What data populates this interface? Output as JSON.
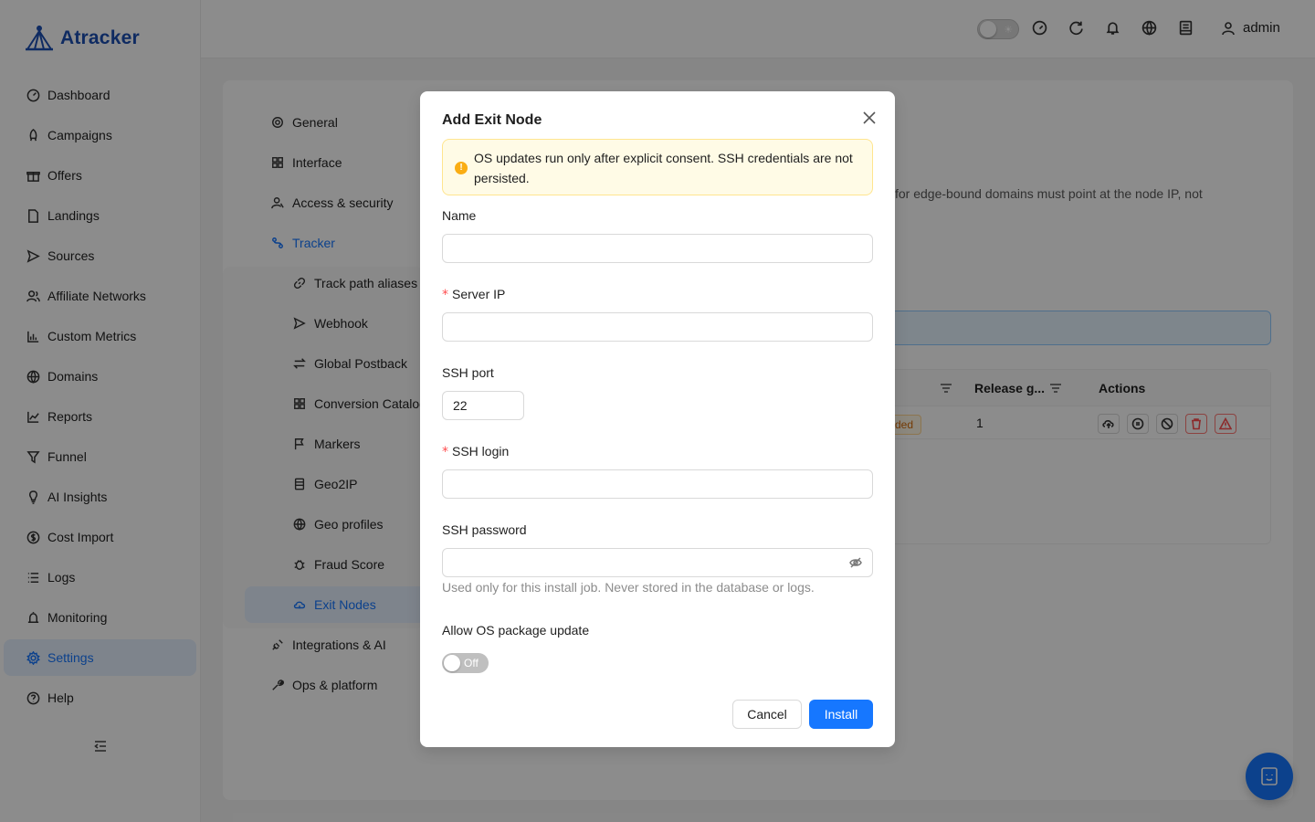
{
  "app": {
    "logo_text": "Atracker"
  },
  "sidebar": {
    "items": [
      {
        "label": "Dashboard",
        "icon": "dashboard-icon"
      },
      {
        "label": "Campaigns",
        "icon": "rocket-icon"
      },
      {
        "label": "Offers",
        "icon": "gift-icon"
      },
      {
        "label": "Landings",
        "icon": "file-icon"
      },
      {
        "label": "Sources",
        "icon": "send-icon"
      },
      {
        "label": "Affiliate Networks",
        "icon": "team-icon"
      },
      {
        "label": "Custom Metrics",
        "icon": "bar-chart-icon"
      },
      {
        "label": "Domains",
        "icon": "globe-icon"
      },
      {
        "label": "Reports",
        "icon": "line-chart-icon"
      },
      {
        "label": "Funnel",
        "icon": "funnel-icon"
      },
      {
        "label": "AI Insights",
        "icon": "bulb-icon"
      },
      {
        "label": "Cost Import",
        "icon": "dollar-icon"
      },
      {
        "label": "Logs",
        "icon": "list-icon"
      },
      {
        "label": "Monitoring",
        "icon": "alert-icon"
      },
      {
        "label": "Settings",
        "icon": "gear-icon",
        "active": true
      },
      {
        "label": "Help",
        "icon": "question-icon"
      }
    ]
  },
  "header": {
    "user_label": "admin"
  },
  "settings_menu": {
    "top_items": [
      {
        "label": "General",
        "icon": "gear-icon"
      },
      {
        "label": "Interface",
        "icon": "grid-icon"
      },
      {
        "label": "Access & security",
        "icon": "user-lock-icon"
      },
      {
        "label": "Tracker",
        "icon": "route-icon",
        "selected": true
      }
    ],
    "tracker_children": [
      {
        "label": "Track path aliases",
        "icon": "link-icon"
      },
      {
        "label": "Webhook",
        "icon": "send-icon"
      },
      {
        "label": "Global Postback",
        "icon": "swap-icon"
      },
      {
        "label": "Conversion Catalog",
        "icon": "grid-icon"
      },
      {
        "label": "Markers",
        "icon": "flag-icon"
      },
      {
        "label": "Geo2IP",
        "icon": "database-icon"
      },
      {
        "label": "Geo profiles",
        "icon": "globe-icon"
      },
      {
        "label": "Fraud Score",
        "icon": "bug-icon"
      },
      {
        "label": "Exit Nodes",
        "icon": "cloud-icon",
        "active": true
      }
    ],
    "bottom_items": [
      {
        "label": "Integrations & AI",
        "icon": "plug-icon"
      },
      {
        "label": "Ops & platform",
        "icon": "tool-icon"
      }
    ]
  },
  "background_page": {
    "description_fragment": "for edge-bound domains must point at the node IP, not",
    "table": {
      "columns": [
        "Release g...",
        "Actions"
      ],
      "row": {
        "status_tag": "ded",
        "release_value": "1"
      }
    }
  },
  "modal": {
    "title": "Add Exit Node",
    "alert_text": "OS updates run only after explicit consent. SSH credentials are not persisted.",
    "fields": {
      "name": {
        "label": "Name",
        "value": "",
        "placeholder": ""
      },
      "server_ip": {
        "label": "Server IP",
        "required": true,
        "value": "",
        "placeholder": ""
      },
      "ssh_port": {
        "label": "SSH port",
        "value": "22"
      },
      "ssh_login": {
        "label": "SSH login",
        "required": true,
        "value": "",
        "placeholder": ""
      },
      "ssh_password": {
        "label": "SSH password",
        "value": "",
        "help": "Used only for this install job. Never stored in the database or logs."
      },
      "os_update": {
        "label": "Allow OS package update",
        "state_label": "Off"
      }
    },
    "required_mark": "*",
    "cancel_label": "Cancel",
    "install_label": "Install"
  },
  "colors": {
    "primary": "#1677ff",
    "brand": "#1d4fb3",
    "warning_bg": "#fffbe6",
    "warning_border": "#ffe58f",
    "danger": "#ff4d4f"
  }
}
